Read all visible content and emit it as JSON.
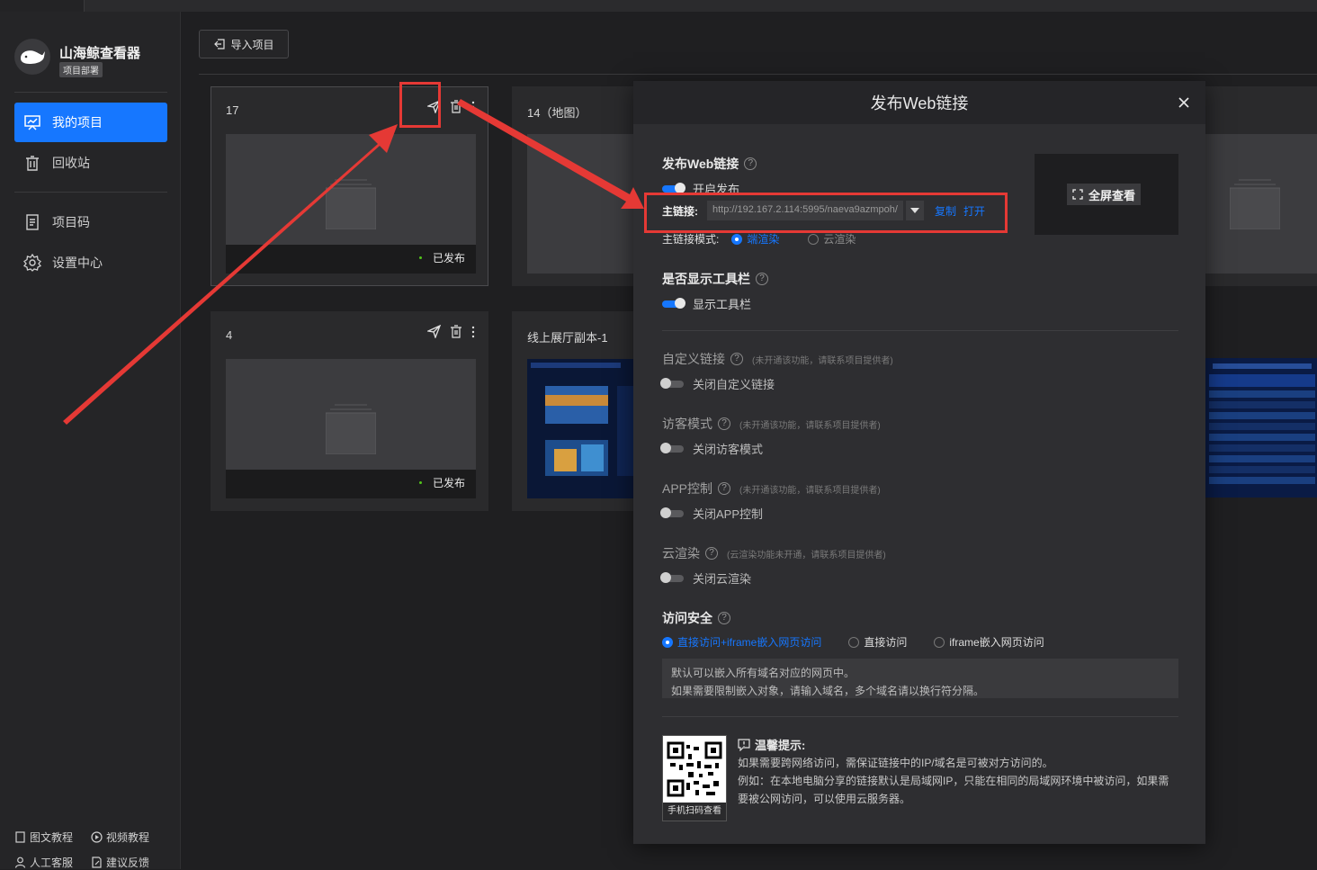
{
  "app": {
    "title": "山海鲸查看器",
    "subtitle": "项目部署"
  },
  "sidebar": {
    "items": [
      {
        "label": "我的项目",
        "icon": "projects-icon",
        "active": true
      },
      {
        "label": "回收站",
        "icon": "trash-icon"
      },
      {
        "label": "项目码",
        "icon": "doc-icon"
      },
      {
        "label": "设置中心",
        "icon": "gear-icon"
      }
    ],
    "footer": {
      "graphic_tutorial": "图文教程",
      "video_tutorial": "视频教程",
      "customer_service": "人工客服",
      "feedback": "建议反馈"
    }
  },
  "toolbar": {
    "import_label": "导入项目"
  },
  "cards": [
    {
      "title": "17",
      "status": "已发布"
    },
    {
      "title": "14（地图）"
    },
    {
      "title": "4",
      "status": "已发布"
    },
    {
      "title": "线上展厅副本-1"
    }
  ],
  "modal": {
    "title": "发布Web链接",
    "publish_section": "发布Web链接",
    "publish_toggle": "开启发布",
    "main_link_label": "主链接:",
    "main_link_value": "http://192.167.2.114:5995/naeva9azmpoh/",
    "copy": "复制",
    "open": "打开",
    "mode_label": "主链接模式:",
    "mode_local": "端渲染",
    "mode_cloud": "云渲染",
    "fullscreen": "全屏查看",
    "toolbar_section": "是否显示工具栏",
    "toolbar_toggle": "显示工具栏",
    "custom_link_section": "自定义链接",
    "custom_link_note": "(未开通该功能，请联系项目提供者)",
    "custom_link_toggle": "关闭自定义链接",
    "visitor_section": "访客模式",
    "visitor_note": "(未开通该功能，请联系项目提供者)",
    "visitor_toggle": "关闭访客模式",
    "app_section": "APP控制",
    "app_note": "(未开通该功能，请联系项目提供者)",
    "app_toggle": "关闭APP控制",
    "cloud_section": "云渲染",
    "cloud_note": "(云渲染功能未开通，请联系项目提供者)",
    "cloud_toggle": "关闭云渲染",
    "security_section": "访问安全",
    "security_options": [
      "直接访问+iframe嵌入网页访问",
      "直接访问",
      "iframe嵌入网页访问"
    ],
    "domain_text_line1": "默认可以嵌入所有域名对应的网页中。",
    "domain_text_line2": "如果需要限制嵌入对象，请输入域名，多个域名请以换行符分隔。",
    "qr_caption": "手机扫码查看",
    "tip_title": "温馨提示:",
    "tip_line1": "如果需要跨网络访问，需保证链接中的IP/域名是可被对方访问的。",
    "tip_line2": "例如：在本地电脑分享的链接默认是局域网IP，只能在相同的局域网环境中被访问，如果需要被公网访问，可以使用云服务器。"
  },
  "colors": {
    "accent": "#1677ff",
    "annotation": "#e53935",
    "published_dot": "#52c41a"
  }
}
